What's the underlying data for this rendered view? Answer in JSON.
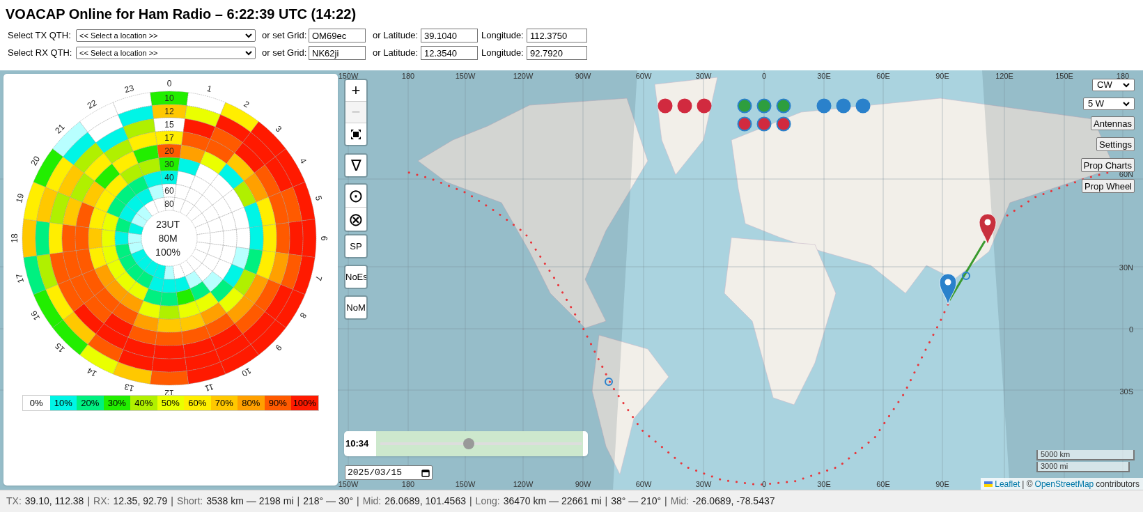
{
  "title": "VOACAP Online for Ham Radio – 6:22:39 UTC (14:22)",
  "qth_rows": [
    {
      "label": "Select TX QTH:",
      "select": "<< Select a location >>",
      "grid_label": "or set Grid:",
      "grid": "OM69ec",
      "lat_label": "or Latitude:",
      "lat": "39.1040",
      "lon_label": "Longitude:",
      "lon": "112.3750"
    },
    {
      "label": "Select RX QTH:",
      "select": "<< Select a location >>",
      "grid_label": "or set Grid:",
      "grid": "NK62ji",
      "lat_label": "or Latitude:",
      "lat": "12.3540",
      "lon_label": "Longitude:",
      "lon": "92.7920"
    }
  ],
  "wheel": {
    "hours": [
      "0",
      "1",
      "2",
      "3",
      "4",
      "5",
      "6",
      "7",
      "8",
      "9",
      "10",
      "11",
      "12",
      "13",
      "14",
      "15",
      "16",
      "17",
      "18",
      "19",
      "20",
      "21",
      "22",
      "23"
    ],
    "center": [
      "23UT",
      "80M",
      "100%"
    ],
    "bands": [
      {
        "label": "10",
        "cells": [
          {
            "color": "#22ee00"
          },
          {
            "color": "#ffffff"
          },
          {
            "color": "#ffee00"
          },
          {
            "color": "#ff1a00"
          },
          {
            "color": "#ff1a00"
          },
          {
            "color": "#ff1a00"
          },
          {
            "color": "#ff1a00"
          },
          {
            "color": "#ff1a00"
          },
          {
            "color": "#ff1a00"
          },
          {
            "color": "#ff1a00"
          },
          {
            "color": "#ff1a00"
          },
          {
            "color": "#ff1a00"
          },
          {
            "color": "#ff5a00"
          },
          {
            "color": "#ffc800"
          },
          {
            "color": "#eaff00"
          },
          {
            "color": "#22ee00"
          },
          {
            "color": "#22ee00"
          },
          {
            "color": "#00f080"
          },
          {
            "color": "#ffc800"
          },
          {
            "color": "#ffee00"
          },
          {
            "color": "#22ee00"
          },
          {
            "color": "#b8ffff"
          },
          {
            "color": "#ffffff"
          },
          {
            "color": "#ffffff"
          }
        ]
      },
      {
        "label": "12",
        "cells": [
          {
            "color": "#ffc800"
          },
          {
            "color": "#eaff00"
          },
          {
            "color": "#ff1a00"
          },
          {
            "color": "#ff1a00"
          },
          {
            "color": "#ff1a00"
          },
          {
            "color": "#ff5a00"
          },
          {
            "color": "#ff1a00"
          },
          {
            "color": "#ff5a00"
          },
          {
            "color": "#ff1a00"
          },
          {
            "color": "#ff1a00"
          },
          {
            "color": "#ff1a00"
          },
          {
            "color": "#ff1a00"
          },
          {
            "color": "#ff1a00"
          },
          {
            "color": "#ff1a00"
          },
          {
            "color": "#ff5a00"
          },
          {
            "color": "#ffc800"
          },
          {
            "color": "#ffee00"
          },
          {
            "color": "#b0f000"
          },
          {
            "color": "#00f080"
          },
          {
            "color": "#ffc800"
          },
          {
            "color": "#ffee00"
          },
          {
            "color": "#00f5e6"
          },
          {
            "color": "#ffffff"
          },
          {
            "color": "#00f5e6"
          }
        ]
      },
      {
        "label": "15",
        "cells": [
          {
            "color": "#ffffff"
          },
          {
            "color": "#ff1a00"
          },
          {
            "color": "#ff5a00"
          },
          {
            "color": "#ff1a00"
          },
          {
            "color": "#ff5a00"
          },
          {
            "color": "#ff5a00"
          },
          {
            "color": "#ff5a00"
          },
          {
            "color": "#ffa000"
          },
          {
            "color": "#ff5a00"
          },
          {
            "color": "#ff5a00"
          },
          {
            "color": "#ff1a00"
          },
          {
            "color": "#ff1a00"
          },
          {
            "color": "#ff1a00"
          },
          {
            "color": "#ff1a00"
          },
          {
            "color": "#ff1a00"
          },
          {
            "color": "#ff1a00"
          },
          {
            "color": "#ff5a00"
          },
          {
            "color": "#ff5a00"
          },
          {
            "color": "#ffee00"
          },
          {
            "color": "#b0f000"
          },
          {
            "color": "#ffc800"
          },
          {
            "color": "#b0f000"
          },
          {
            "color": "#00f5e6"
          },
          {
            "color": "#b0f000"
          }
        ]
      },
      {
        "label": "17",
        "cells": [
          {
            "color": "#ffee00"
          },
          {
            "color": "#ff5a00"
          },
          {
            "color": "#ff5a00"
          },
          {
            "color": "#ffc800"
          },
          {
            "color": "#ffa000"
          },
          {
            "color": "#ffee00"
          },
          {
            "color": "#ffee00"
          },
          {
            "color": "#ffee00"
          },
          {
            "color": "#ffa000"
          },
          {
            "color": "#ffa000"
          },
          {
            "color": "#ff5a00"
          },
          {
            "color": "#ff5a00"
          },
          {
            "color": "#ff5a00"
          },
          {
            "color": "#ff5a00"
          },
          {
            "color": "#ff1a00"
          },
          {
            "color": "#ff5a00"
          },
          {
            "color": "#ff5a00"
          },
          {
            "color": "#ff5a00"
          },
          {
            "color": "#ff5a00"
          },
          {
            "color": "#ffc800"
          },
          {
            "color": "#b0f000"
          },
          {
            "color": "#ffee00"
          },
          {
            "color": "#b0f000"
          },
          {
            "color": "#ffee00"
          }
        ]
      },
      {
        "label": "20",
        "cells": [
          {
            "color": "#ff5a00"
          },
          {
            "color": "#ffa000"
          },
          {
            "color": "#eaff00"
          },
          {
            "color": "#00f5e6"
          },
          {
            "color": "#b0f000"
          },
          {
            "color": "#00f5e6"
          },
          {
            "color": "#00f5e6"
          },
          {
            "color": "#00f080"
          },
          {
            "color": "#b0f000"
          },
          {
            "color": "#eaff00"
          },
          {
            "color": "#ffa000"
          },
          {
            "color": "#ffc800"
          },
          {
            "color": "#ffc800"
          },
          {
            "color": "#ffa000"
          },
          {
            "color": "#ff5a00"
          },
          {
            "color": "#ff5a00"
          },
          {
            "color": "#ff5a00"
          },
          {
            "color": "#ff5a00"
          },
          {
            "color": "#ff5a00"
          },
          {
            "color": "#ff5a00"
          },
          {
            "color": "#ffc800"
          },
          {
            "color": "#22ee00"
          },
          {
            "color": "#ffee00"
          },
          {
            "color": "#22ee00"
          }
        ]
      },
      {
        "label": "30",
        "cells": [
          {
            "color": "#22ee00"
          },
          {
            "color": "#00f5e6"
          },
          {
            "color": "#ffffff"
          },
          {
            "color": "#ffffff"
          },
          {
            "color": "#ffffff"
          },
          {
            "color": "#ffffff"
          },
          {
            "color": "#ffffff"
          },
          {
            "color": "#b8ffff"
          },
          {
            "color": "#00f5e6"
          },
          {
            "color": "#00f080"
          },
          {
            "color": "#eaff00"
          },
          {
            "color": "#eaff00"
          },
          {
            "color": "#b0f000"
          },
          {
            "color": "#eaff00"
          },
          {
            "color": "#ffa000"
          },
          {
            "color": "#ffa000"
          },
          {
            "color": "#ffa000"
          },
          {
            "color": "#ffee00"
          },
          {
            "color": "#ffc800"
          },
          {
            "color": "#ffee00"
          },
          {
            "color": "#ffee00"
          },
          {
            "color": "#ffee00"
          },
          {
            "color": "#b0f000"
          },
          {
            "color": "#b0f000"
          }
        ]
      },
      {
        "label": "40",
        "cells": [
          {
            "color": "#00f5e6"
          },
          {
            "color": "#ffffff"
          },
          {
            "color": "#ffffff"
          },
          {
            "color": "#ffffff"
          },
          {
            "color": "#ffffff"
          },
          {
            "color": "#ffffff"
          },
          {
            "color": "#ffffff"
          },
          {
            "color": "#ffffff"
          },
          {
            "color": "#ffffff"
          },
          {
            "color": "#b8ffff"
          },
          {
            "color": "#00f080"
          },
          {
            "color": "#22ee00"
          },
          {
            "color": "#00f080"
          },
          {
            "color": "#00f080"
          },
          {
            "color": "#eaff00"
          },
          {
            "color": "#eaff00"
          },
          {
            "color": "#eaff00"
          },
          {
            "color": "#eaff00"
          },
          {
            "color": "#eaff00"
          },
          {
            "color": "#eaff00"
          },
          {
            "color": "#00f080"
          },
          {
            "color": "#00f080"
          },
          {
            "color": "#00f080"
          },
          {
            "color": "#00f5e6"
          }
        ]
      },
      {
        "label": "60",
        "cells": [
          {
            "color": "#ffffff"
          },
          {
            "color": "#ffffff"
          },
          {
            "color": "#ffffff"
          },
          {
            "color": "#ffffff"
          },
          {
            "color": "#ffffff"
          },
          {
            "color": "#ffffff"
          },
          {
            "color": "#ffffff"
          },
          {
            "color": "#ffffff"
          },
          {
            "color": "#ffffff"
          },
          {
            "color": "#ffffff"
          },
          {
            "color": "#b8ffff"
          },
          {
            "color": "#00f5e6"
          },
          {
            "color": "#00f5e6"
          },
          {
            "color": "#00f5e6"
          },
          {
            "color": "#00f080"
          },
          {
            "color": "#00f080"
          },
          {
            "color": "#00f080"
          },
          {
            "color": "#00f080"
          },
          {
            "color": "#00f5e6"
          },
          {
            "color": "#00f080"
          },
          {
            "color": "#00f5e6"
          },
          {
            "color": "#00f5e6"
          },
          {
            "color": "#00f5e6"
          },
          {
            "color": "#b8ffff"
          }
        ]
      },
      {
        "label": "80",
        "cells": [
          {
            "color": "#ffffff"
          },
          {
            "color": "#ffffff"
          },
          {
            "color": "#ffffff"
          },
          {
            "color": "#ffffff"
          },
          {
            "color": "#ffffff"
          },
          {
            "color": "#ffffff"
          },
          {
            "color": "#ffffff"
          },
          {
            "color": "#ffffff"
          },
          {
            "color": "#ffffff"
          },
          {
            "color": "#ffffff"
          },
          {
            "color": "#ffffff"
          },
          {
            "color": "#ffffff"
          },
          {
            "color": "#b8ffff"
          },
          {
            "color": "#00f5e6"
          },
          {
            "color": "#00f5e6"
          },
          {
            "color": "#00f5e6"
          },
          {
            "color": "#00f5e6"
          },
          {
            "color": "#b8ffff"
          },
          {
            "color": "#b8ffff"
          },
          {
            "color": "#00f5e6"
          },
          {
            "color": "#b8ffff"
          },
          {
            "color": "#b8ffff"
          },
          {
            "color": "#ffffff"
          },
          {
            "color": "#ffffff"
          }
        ]
      }
    ],
    "legend": [
      {
        "label": "0%",
        "color": "#ffffff"
      },
      {
        "label": "10%",
        "color": "#00f5e6"
      },
      {
        "label": "20%",
        "color": "#00f080"
      },
      {
        "label": "30%",
        "color": "#22ee00"
      },
      {
        "label": "40%",
        "color": "#b0f000"
      },
      {
        "label": "50%",
        "color": "#eaff00"
      },
      {
        "label": "60%",
        "color": "#ffee00"
      },
      {
        "label": "70%",
        "color": "#ffc800"
      },
      {
        "label": "80%",
        "color": "#ffa000"
      },
      {
        "label": "90%",
        "color": "#ff5a00"
      },
      {
        "label": "100%",
        "color": "#ff1a00"
      }
    ]
  },
  "map": {
    "top_labels": [
      "150W",
      "180",
      "150W",
      "120W",
      "90W",
      "60W",
      "30W",
      "0",
      "30E",
      "60E",
      "90E",
      "120E",
      "150E",
      "180"
    ],
    "bottom_labels": [
      "150W",
      "180",
      "150W",
      "120W",
      "90W",
      "60W",
      "30W",
      "0",
      "30E",
      "60E",
      "90E"
    ],
    "side_labels": [
      "60N",
      "30N",
      "0",
      "30S"
    ],
    "zoom_buttons": [
      {
        "label": "+",
        "disabled": false
      },
      {
        "label": "−",
        "disabled": true
      }
    ],
    "symbol_buttons": [
      "∇",
      "⊙",
      "⊗"
    ],
    "text_buttons": [
      "SP",
      "NoEs",
      "NoM"
    ],
    "indicator_groups": [
      {
        "outlined": false,
        "rows": [
          [
            {
              "color": "#d12a3f"
            },
            {
              "color": "#d12a3f"
            },
            {
              "color": "#d12a3f"
            }
          ]
        ]
      },
      {
        "outlined": true,
        "rows": [
          [
            {
              "color": "#2e9e3e"
            },
            {
              "color": "#2e9e3e"
            },
            {
              "color": "#2e9e3e"
            }
          ],
          [
            {
              "color": "#d12a3f"
            },
            {
              "color": "#d12a3f"
            },
            {
              "color": "#d12a3f"
            }
          ]
        ]
      },
      {
        "outlined": false,
        "rows": [
          [
            {
              "color": "#2a81cb"
            },
            {
              "color": "#2a81cb"
            },
            {
              "color": "#2a81cb"
            }
          ]
        ]
      }
    ],
    "mode": "CW",
    "power": "5 W",
    "panel_buttons": [
      "Antennas",
      "Settings",
      "Prop Charts",
      "Prop Wheel"
    ],
    "time": {
      "label": "10:34",
      "level": 0.44
    },
    "date": "2025/03/15",
    "scale": [
      "5000 km",
      "3000 mi"
    ],
    "attribution": {
      "link": "Leaflet",
      "separator": "| ©",
      "osm": "OpenStreetMap",
      "rest": "contributors"
    }
  },
  "status_bar": [
    {
      "label": "TX:",
      "value": "39.10, 112.38"
    },
    {
      "label": "RX:",
      "value": "12.35, 92.79"
    },
    {
      "label": "Short:",
      "value": "3538 km — 2198 mi"
    },
    {
      "value": "218° — 30°"
    },
    {
      "label": "Mid:",
      "value": "26.0689, 101.4563"
    },
    {
      "label": "Long:",
      "value": "36470 km — 22661 mi"
    },
    {
      "value": "38° — 210°"
    },
    {
      "label": "Mid:",
      "value": "-26.0689, -78.5437"
    }
  ],
  "status_separator": "|"
}
